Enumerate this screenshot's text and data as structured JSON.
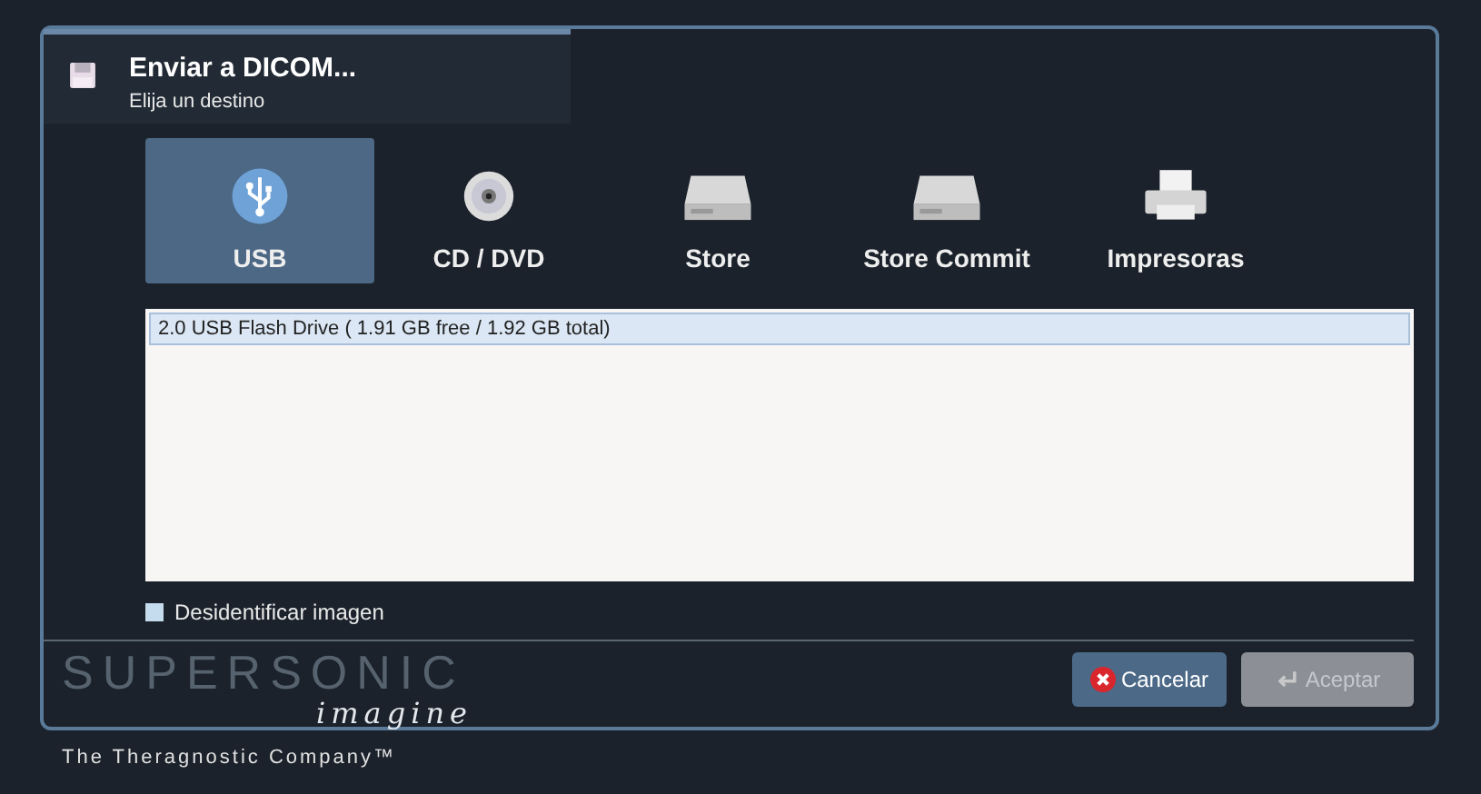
{
  "dialog": {
    "title": "Enviar a DICOM...",
    "subtitle": "Elija un destino"
  },
  "destinations": [
    {
      "kind": "usb",
      "label": "USB",
      "selected": true
    },
    {
      "kind": "disc",
      "label": "CD / DVD",
      "selected": false
    },
    {
      "kind": "store",
      "label": "Store",
      "selected": false
    },
    {
      "kind": "store",
      "label": "Store Commit",
      "selected": false
    },
    {
      "kind": "printer",
      "label": "Impresoras",
      "selected": false
    }
  ],
  "devices": [
    {
      "label": "2.0 USB Flash Drive ( 1.91 GB free / 1.92 GB total)",
      "selected": true
    }
  ],
  "deidentify": {
    "label": "Desidentificar imagen",
    "checked": false
  },
  "buttons": [
    {
      "kind": "cancel",
      "label": "Cancelar",
      "disabled": false
    },
    {
      "kind": "accept",
      "label": "Aceptar",
      "disabled": true
    }
  ],
  "logo": {
    "wordmark": "SUPERSONIC",
    "subline": "imagine",
    "tagline": "The Theragnostic Company™"
  }
}
